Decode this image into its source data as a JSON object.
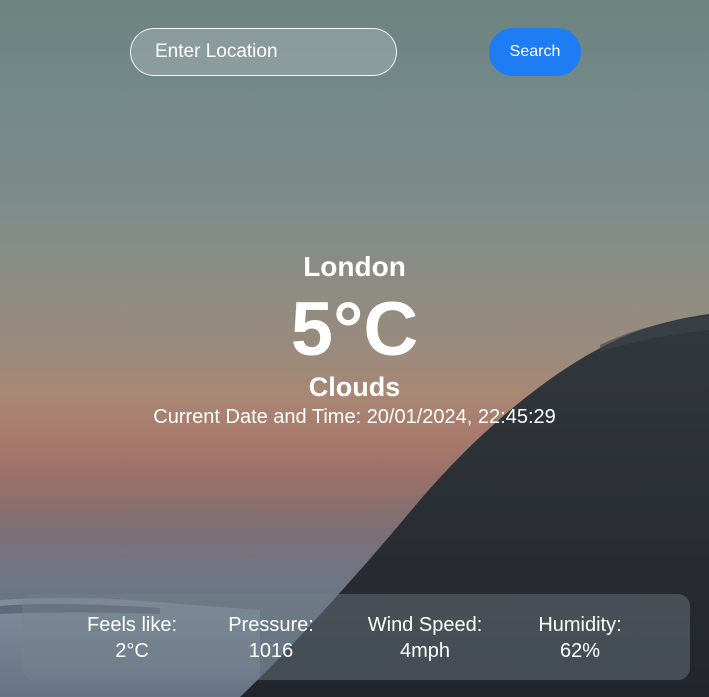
{
  "search": {
    "placeholder": "Enter Location",
    "button_label": "Search"
  },
  "weather": {
    "city": "London",
    "temperature": "5°C",
    "condition": "Clouds",
    "datetime_label": "Current Date and Time:",
    "datetime_value": "20/01/2024, 22:45:29"
  },
  "details": [
    {
      "label": "Feels like:",
      "value": "2°C"
    },
    {
      "label": "Pressure:",
      "value": "1016"
    },
    {
      "label": "Wind Speed:",
      "value": "4mph"
    },
    {
      "label": "Humidity:",
      "value": "62%"
    }
  ],
  "colors": {
    "accent": "#1e7cf5",
    "text": "#ffffff"
  }
}
